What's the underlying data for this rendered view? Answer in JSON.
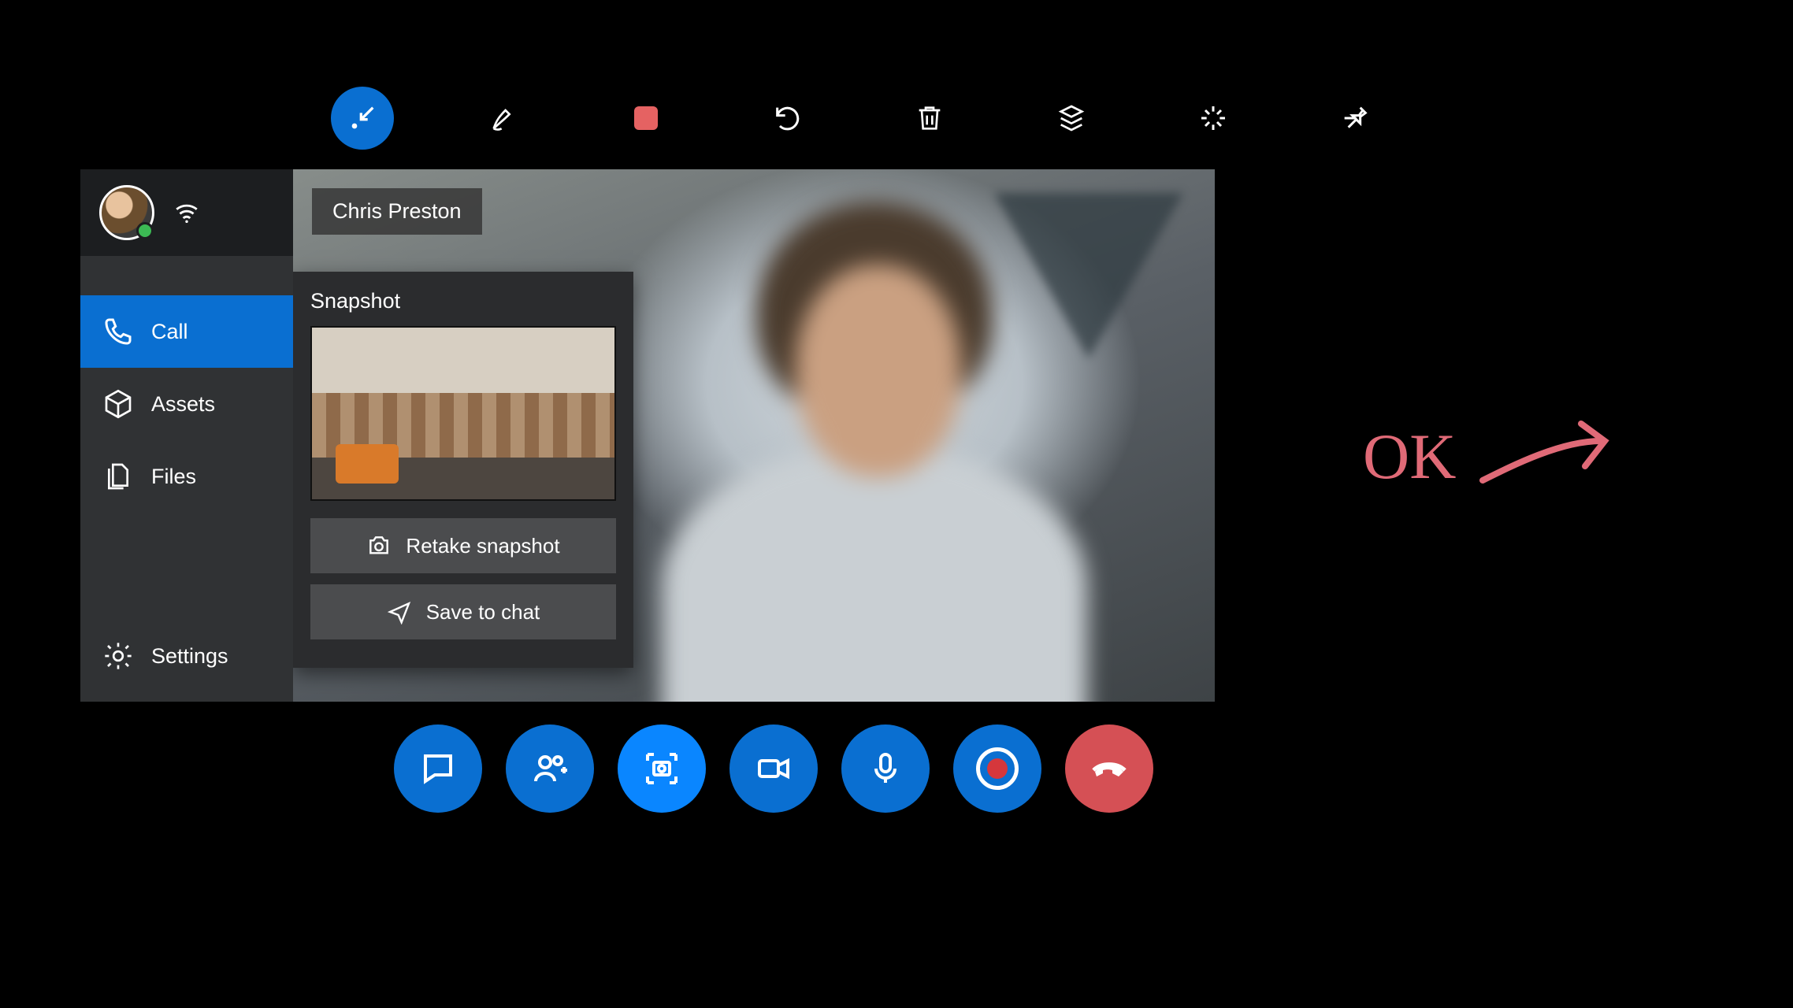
{
  "participant": {
    "name": "Chris Preston"
  },
  "sidebar": {
    "items": [
      {
        "label": "Call",
        "icon": "phone-icon",
        "active": true
      },
      {
        "label": "Assets",
        "icon": "package-icon",
        "active": false
      },
      {
        "label": "Files",
        "icon": "files-icon",
        "active": false
      },
      {
        "label": "Settings",
        "icon": "gear-icon",
        "active": false
      }
    ]
  },
  "snapshot_panel": {
    "title": "Snapshot",
    "retake_label": "Retake snapshot",
    "save_label": "Save to chat"
  },
  "toolbar": {
    "items": [
      {
        "name": "collapse-arrows-icon",
        "active": true
      },
      {
        "name": "pen-icon",
        "active": false
      },
      {
        "name": "stop-recording-icon",
        "active": false
      },
      {
        "name": "undo-icon",
        "active": false
      },
      {
        "name": "trash-icon",
        "active": false
      },
      {
        "name": "layers-icon",
        "active": false
      },
      {
        "name": "expand-icon",
        "active": false
      },
      {
        "name": "pin-icon",
        "active": false
      }
    ]
  },
  "call_controls": {
    "items": [
      {
        "name": "chat-icon",
        "style": "blue"
      },
      {
        "name": "add-people-icon",
        "style": "blue"
      },
      {
        "name": "camera-snap-icon",
        "style": "bright"
      },
      {
        "name": "video-icon",
        "style": "blue"
      },
      {
        "name": "mic-icon",
        "style": "blue"
      },
      {
        "name": "record-icon",
        "style": "blue"
      },
      {
        "name": "hang-up-icon",
        "style": "red"
      }
    ]
  },
  "annotation": {
    "text": "OK"
  },
  "colors": {
    "primary": "#0a6fd1",
    "danger": "#d55055",
    "ink": "#e06a77"
  }
}
